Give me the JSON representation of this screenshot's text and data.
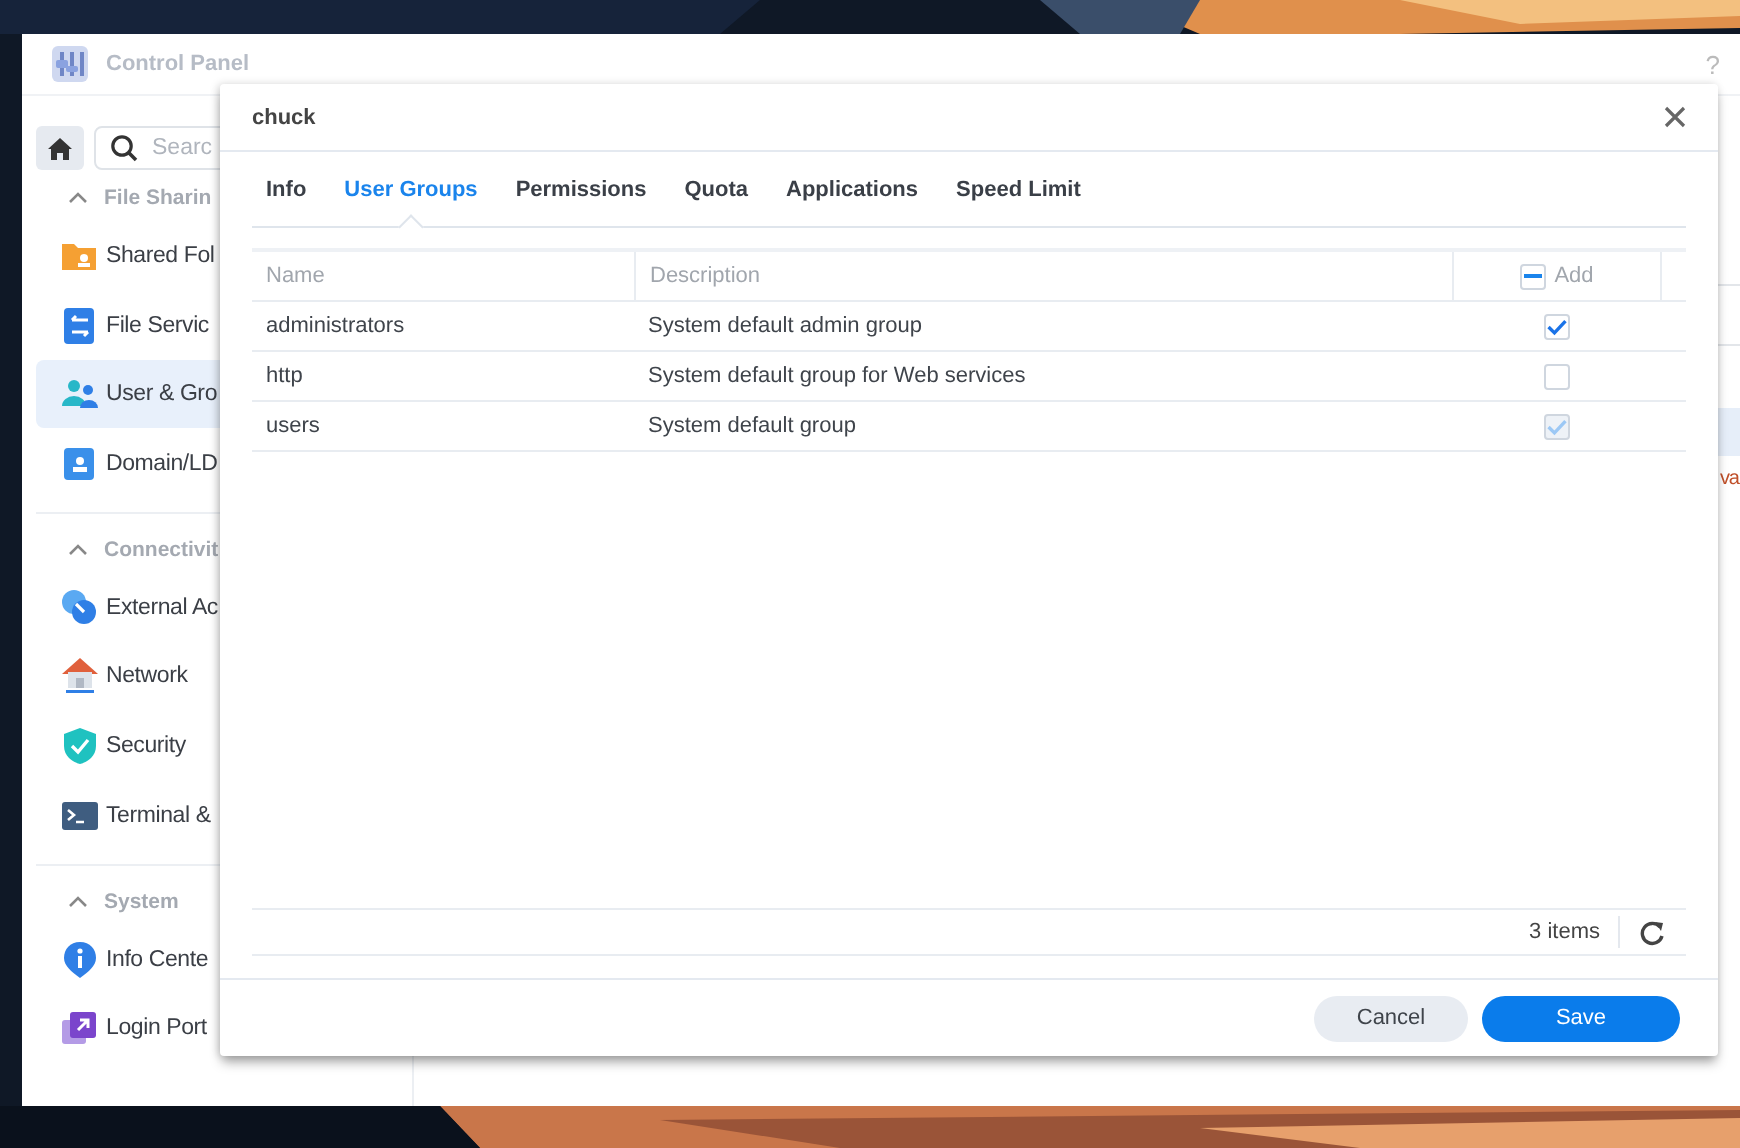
{
  "background_window": {
    "title": "Control Panel",
    "help": "?",
    "search": {
      "placeholder": "Searc"
    },
    "side_note": "va"
  },
  "sidebar": {
    "sections": [
      {
        "title": "File Sharin",
        "expanded": true,
        "items": [
          {
            "label": "Shared Fol",
            "selected": false
          },
          {
            "label": "File Servic",
            "selected": false
          },
          {
            "label": "User & Gro",
            "selected": true
          },
          {
            "label": "Domain/LD",
            "selected": false
          }
        ]
      },
      {
        "title": "Connectivit",
        "expanded": true,
        "items": [
          {
            "label": "External Ac",
            "selected": false
          },
          {
            "label": "Network",
            "selected": false
          },
          {
            "label": "Security",
            "selected": false
          },
          {
            "label": "Terminal &",
            "selected": false
          }
        ]
      },
      {
        "title": "System",
        "expanded": true,
        "items": [
          {
            "label": "Info Cente",
            "selected": false
          },
          {
            "label": "Login Port",
            "selected": false
          }
        ]
      }
    ]
  },
  "dialog": {
    "title": "chuck",
    "tabs": [
      {
        "label": "Info",
        "selected": false
      },
      {
        "label": "User Groups",
        "selected": true
      },
      {
        "label": "Permissions",
        "selected": false
      },
      {
        "label": "Quota",
        "selected": false
      },
      {
        "label": "Applications",
        "selected": false
      },
      {
        "label": "Speed Limit",
        "selected": false
      }
    ],
    "table": {
      "columns": [
        "Name",
        "Description"
      ],
      "add_column": {
        "label": "Add",
        "indeterminate": true
      },
      "rows": [
        {
          "name": "administrators",
          "description": "System default admin group",
          "checked": true,
          "disabled": false
        },
        {
          "name": "http",
          "description": "System default group for Web services",
          "checked": false,
          "disabled": false
        },
        {
          "name": "users",
          "description": "System default group",
          "checked": true,
          "disabled": true
        }
      ]
    },
    "item_count": "3 items",
    "buttons": [
      {
        "label": "Cancel",
        "kind": "secondary"
      },
      {
        "label": "Save",
        "kind": "primary"
      }
    ]
  }
}
